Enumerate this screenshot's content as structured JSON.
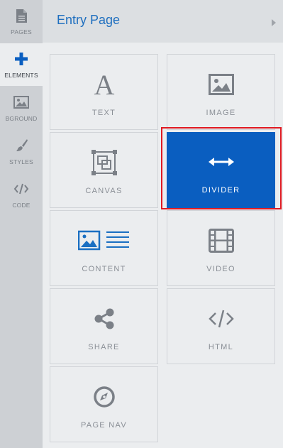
{
  "header": {
    "title": "Entry Page",
    "expand_icon": "chevron-right-icon"
  },
  "sidebar": {
    "items": [
      {
        "label": "PAGES",
        "icon": "pages-icon",
        "active": false
      },
      {
        "label": "ELEMENTS",
        "icon": "plus-icon",
        "active": true
      },
      {
        "label": "BGROUND",
        "icon": "image-icon",
        "active": false
      },
      {
        "label": "STYLES",
        "icon": "brush-icon",
        "active": false
      },
      {
        "label": "CODE",
        "icon": "code-icon",
        "active": false
      }
    ]
  },
  "elements": {
    "tiles": [
      {
        "label": "TEXT",
        "icon": "text-icon"
      },
      {
        "label": "IMAGE",
        "icon": "image-icon"
      },
      {
        "label": "CANVAS",
        "icon": "canvas-icon"
      },
      {
        "label": "DIVIDER",
        "icon": "divider-icon",
        "selected": true
      },
      {
        "label": "CONTENT",
        "icon": "content-icon"
      },
      {
        "label": "VIDEO",
        "icon": "video-icon"
      },
      {
        "label": "SHARE",
        "icon": "share-icon"
      },
      {
        "label": "HTML",
        "icon": "html-icon"
      },
      {
        "label": "PAGE NAV",
        "icon": "compass-icon"
      }
    ]
  },
  "colors": {
    "accent": "#1f6fbf",
    "selected_tile": "#0a5ec0",
    "highlight_border": "#e01a22",
    "content_icon_blue": "#1a6fc2"
  }
}
